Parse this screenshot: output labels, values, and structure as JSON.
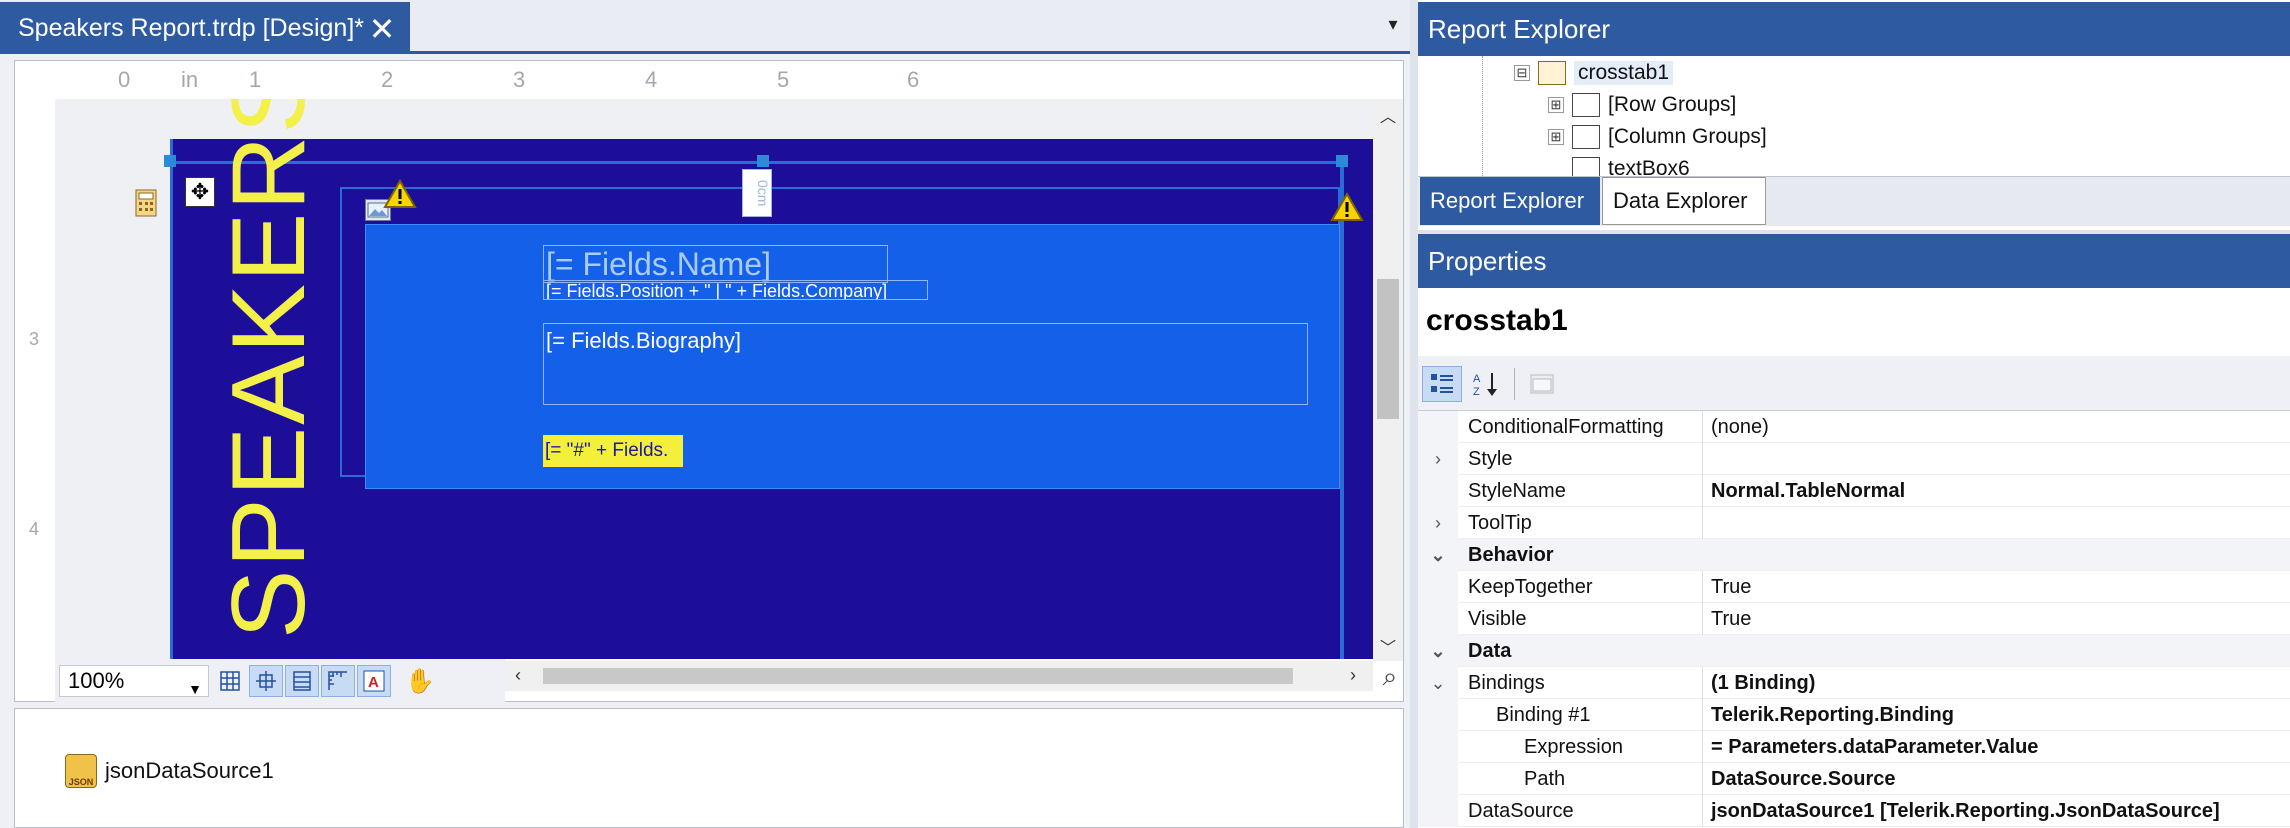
{
  "document_tab": {
    "title": "Speakers Report.trdp [Design]*",
    "close": "✕",
    "dropdown": "▾"
  },
  "ruler": {
    "unit": "in",
    "h_ticks": [
      "0",
      "in",
      "1",
      "2",
      "3",
      "4",
      "5",
      "6"
    ],
    "v_ticks": [
      "3",
      "4"
    ]
  },
  "report": {
    "speakers": "SPEAKERS",
    "vertical_label": "0cm",
    "field_name": "[= Fields.Name]",
    "field_position": "[= Fields.Position + \" | \" + Fields.Company]",
    "field_bio": "[= Fields.Biography]",
    "field_number": "[= \"#\" + Fields.",
    "colors": {
      "body": "#1d0e9a",
      "panel": "#1460e8",
      "speakers": "#f4f04a"
    }
  },
  "designer_toolbar": {
    "zoom": "100%"
  },
  "tray": {
    "datasource": "jsonDataSource1",
    "icon_text": "JSON"
  },
  "report_explorer": {
    "title": "Report Explorer",
    "tree": [
      {
        "label": "crosstab1",
        "expander": "⊟"
      },
      {
        "label": "[Row Groups]",
        "expander": "⊞"
      },
      {
        "label": "[Column Groups]",
        "expander": "⊞"
      },
      {
        "label": "textBox6",
        "expander": ""
      }
    ],
    "tabs": [
      "Report Explorer",
      "Data Explorer"
    ]
  },
  "properties": {
    "title": "Properties",
    "object": "crosstab1",
    "rows": [
      {
        "name": "ConditionalFormatting",
        "value": "(none)",
        "gutter": "",
        "cat": false,
        "bold": false,
        "indent": 0
      },
      {
        "name": "Style",
        "value": "",
        "gutter": "›",
        "cat": false,
        "bold": false,
        "indent": 0
      },
      {
        "name": "StyleName",
        "value": "Normal.TableNormal",
        "gutter": "",
        "cat": false,
        "bold": true,
        "indent": 0
      },
      {
        "name": "ToolTip",
        "value": "",
        "gutter": "›",
        "cat": false,
        "bold": false,
        "indent": 0
      },
      {
        "name": "Behavior",
        "value": "",
        "gutter": "⌄",
        "cat": true,
        "bold": false,
        "indent": 0
      },
      {
        "name": "KeepTogether",
        "value": "True",
        "gutter": "",
        "cat": false,
        "bold": false,
        "indent": 0
      },
      {
        "name": "Visible",
        "value": "True",
        "gutter": "",
        "cat": false,
        "bold": false,
        "indent": 0
      },
      {
        "name": "Data",
        "value": "",
        "gutter": "⌄",
        "cat": true,
        "bold": false,
        "indent": 0
      },
      {
        "name": "Bindings",
        "value": "(1 Binding)",
        "gutter": "⌄",
        "cat": false,
        "bold": true,
        "indent": 0
      },
      {
        "name": "Binding #1",
        "value": "Telerik.Reporting.Binding",
        "gutter": "",
        "cat": false,
        "bold": true,
        "indent": 1
      },
      {
        "name": "Expression",
        "value": "= Parameters.dataParameter.Value",
        "gutter": "",
        "cat": false,
        "bold": true,
        "indent": 2
      },
      {
        "name": "Path",
        "value": "DataSource.Source",
        "gutter": "",
        "cat": false,
        "bold": true,
        "indent": 2
      },
      {
        "name": "DataSource",
        "value": "jsonDataSource1 [Telerik.Reporting.JsonDataSource]",
        "gutter": "",
        "cat": false,
        "bold": true,
        "indent": 0
      }
    ]
  }
}
